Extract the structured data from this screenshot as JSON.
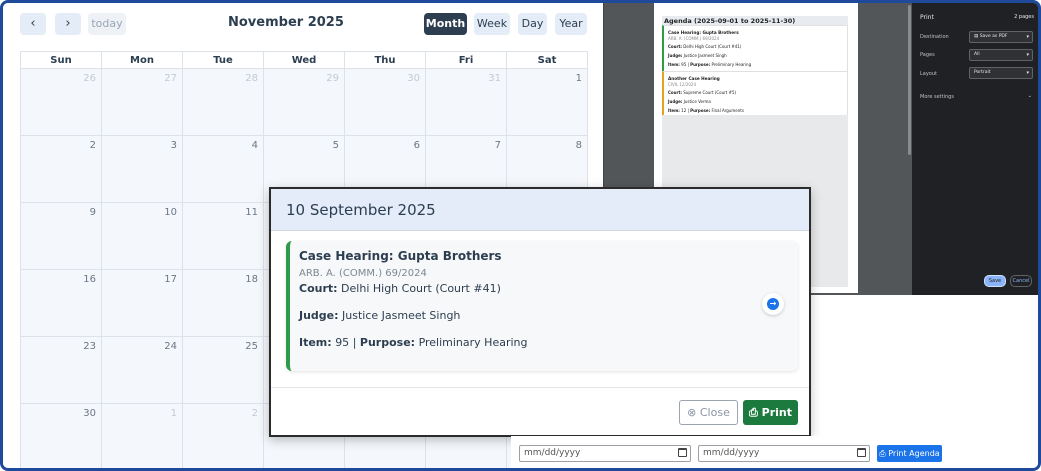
{
  "calendar": {
    "title": "November 2025",
    "nav": {
      "prev": "‹",
      "next": "›",
      "today": "today"
    },
    "views": [
      "Month",
      "Week",
      "Day",
      "Year"
    ],
    "active_view": "Month",
    "days_of_week": [
      "Sun",
      "Mon",
      "Tue",
      "Wed",
      "Thu",
      "Fri",
      "Sat"
    ],
    "weeks": [
      [
        {
          "n": "26",
          "o": true
        },
        {
          "n": "27",
          "o": true
        },
        {
          "n": "28",
          "o": true
        },
        {
          "n": "29",
          "o": true
        },
        {
          "n": "30",
          "o": true
        },
        {
          "n": "31",
          "o": true
        },
        {
          "n": "1",
          "o": false
        }
      ],
      [
        {
          "n": "2",
          "o": false
        },
        {
          "n": "3",
          "o": false
        },
        {
          "n": "4",
          "o": false
        },
        {
          "n": "5",
          "o": false
        },
        {
          "n": "6",
          "o": false
        },
        {
          "n": "7",
          "o": false
        },
        {
          "n": "8",
          "o": false
        }
      ],
      [
        {
          "n": "9",
          "o": false
        },
        {
          "n": "10",
          "o": false
        },
        {
          "n": "11",
          "o": false
        },
        {
          "n": "",
          "o": false
        },
        {
          "n": "",
          "o": false
        },
        {
          "n": "",
          "o": false
        },
        {
          "n": "",
          "o": false
        }
      ],
      [
        {
          "n": "16",
          "o": false
        },
        {
          "n": "17",
          "o": false
        },
        {
          "n": "18",
          "o": false
        },
        {
          "n": "",
          "o": false
        },
        {
          "n": "",
          "o": false
        },
        {
          "n": "",
          "o": false
        },
        {
          "n": "",
          "o": false
        }
      ],
      [
        {
          "n": "23",
          "o": false
        },
        {
          "n": "24",
          "o": false
        },
        {
          "n": "25",
          "o": false
        },
        {
          "n": "",
          "o": false
        },
        {
          "n": "",
          "o": false
        },
        {
          "n": "",
          "o": false
        },
        {
          "n": "",
          "o": false
        }
      ],
      [
        {
          "n": "30",
          "o": false
        },
        {
          "n": "1",
          "o": true
        },
        {
          "n": "2",
          "o": true
        },
        {
          "n": "",
          "o": false
        },
        {
          "n": "",
          "o": false
        },
        {
          "n": "",
          "o": false
        },
        {
          "n": "",
          "o": false
        }
      ]
    ]
  },
  "print_preview": {
    "page_title": "Agenda (2025-09-01 to 2025-11-30)",
    "cards": [
      {
        "title": "Case Hearing: Gupta Brothers",
        "case": "ARB. A. (COMM.) 69/2024",
        "court": "Delhi High Court (Court #41)",
        "judge": "Justice Jasmeet Singh",
        "item": "95",
        "purpose": "Preliminary Hearing",
        "color": "#2e9a4a"
      },
      {
        "title": "Another Case Hearing",
        "case": "CIVIL 12/2024",
        "court": "Supreme Court (Court #5)",
        "judge": "Justice Verma",
        "item": "12",
        "purpose": "Final Arguments",
        "color": "#e8a020"
      }
    ],
    "sidebar": {
      "header": "Print",
      "pages_count": "2 pages",
      "destination_label": "Destination",
      "destination_value": "Save as PDF",
      "pages_label": "Pages",
      "pages_value": "All",
      "layout_label": "Layout",
      "layout_value": "Portrait",
      "more_settings": "More settings",
      "save": "Save",
      "cancel": "Cancel"
    }
  },
  "modal": {
    "date_title": "10 September 2025",
    "event": {
      "title": "Case Hearing: Gupta Brothers",
      "case_number": "ARB. A. (COMM.) 69/2024",
      "court_label": "Court:",
      "court": "Delhi High Court (Court #41)",
      "judge_label": "Judge:",
      "judge": "Justice Jasmeet Singh",
      "item_label": "Item:",
      "item": "95",
      "separator": "|",
      "purpose_label": "Purpose:",
      "purpose": "Preliminary Hearing",
      "color": "#2e9a4a"
    },
    "close": "Close",
    "print": "Print"
  },
  "agenda_form": {
    "start_placeholder": "mm/dd/yyyy",
    "end_placeholder": "mm/dd/yyyy",
    "print_button": "Print Agenda"
  }
}
